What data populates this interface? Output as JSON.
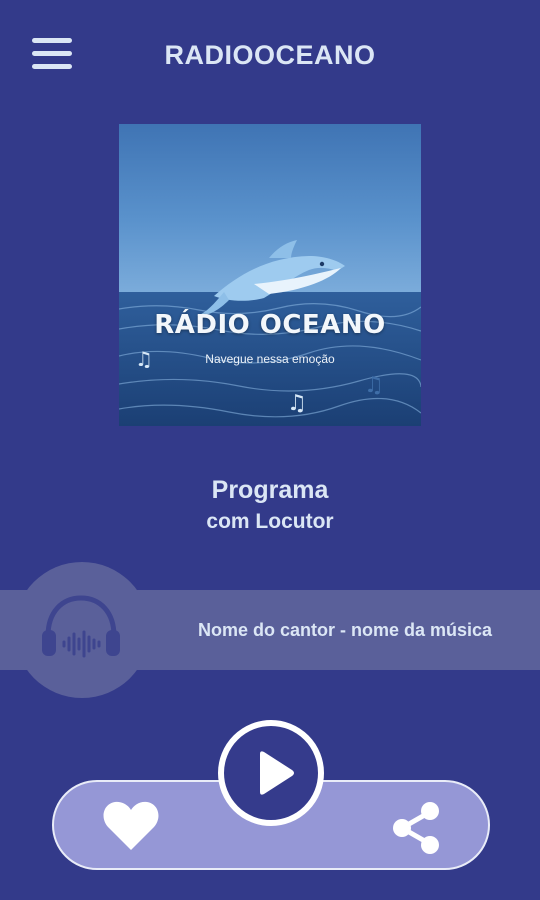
{
  "header": {
    "menu_icon": "hamburger-menu-icon",
    "title": "RADIOOCEANO"
  },
  "cover": {
    "brand": "RÁDIO OCEANO",
    "slogan": "Navegue nessa emoção"
  },
  "program": {
    "title": "Programa",
    "host": "com Locutor"
  },
  "now_playing": {
    "icon": "headphones-icon",
    "text": "Nome do cantor - nome da música"
  },
  "controls": {
    "favorite_icon": "heart-icon",
    "play_icon": "play-icon",
    "share_icon": "share-icon"
  },
  "colors": {
    "background": "#333a8a",
    "text": "#dbe6f5",
    "now_bar": "#5a609a",
    "controls_bar": "#9597d6",
    "play_border": "#ffffff"
  }
}
